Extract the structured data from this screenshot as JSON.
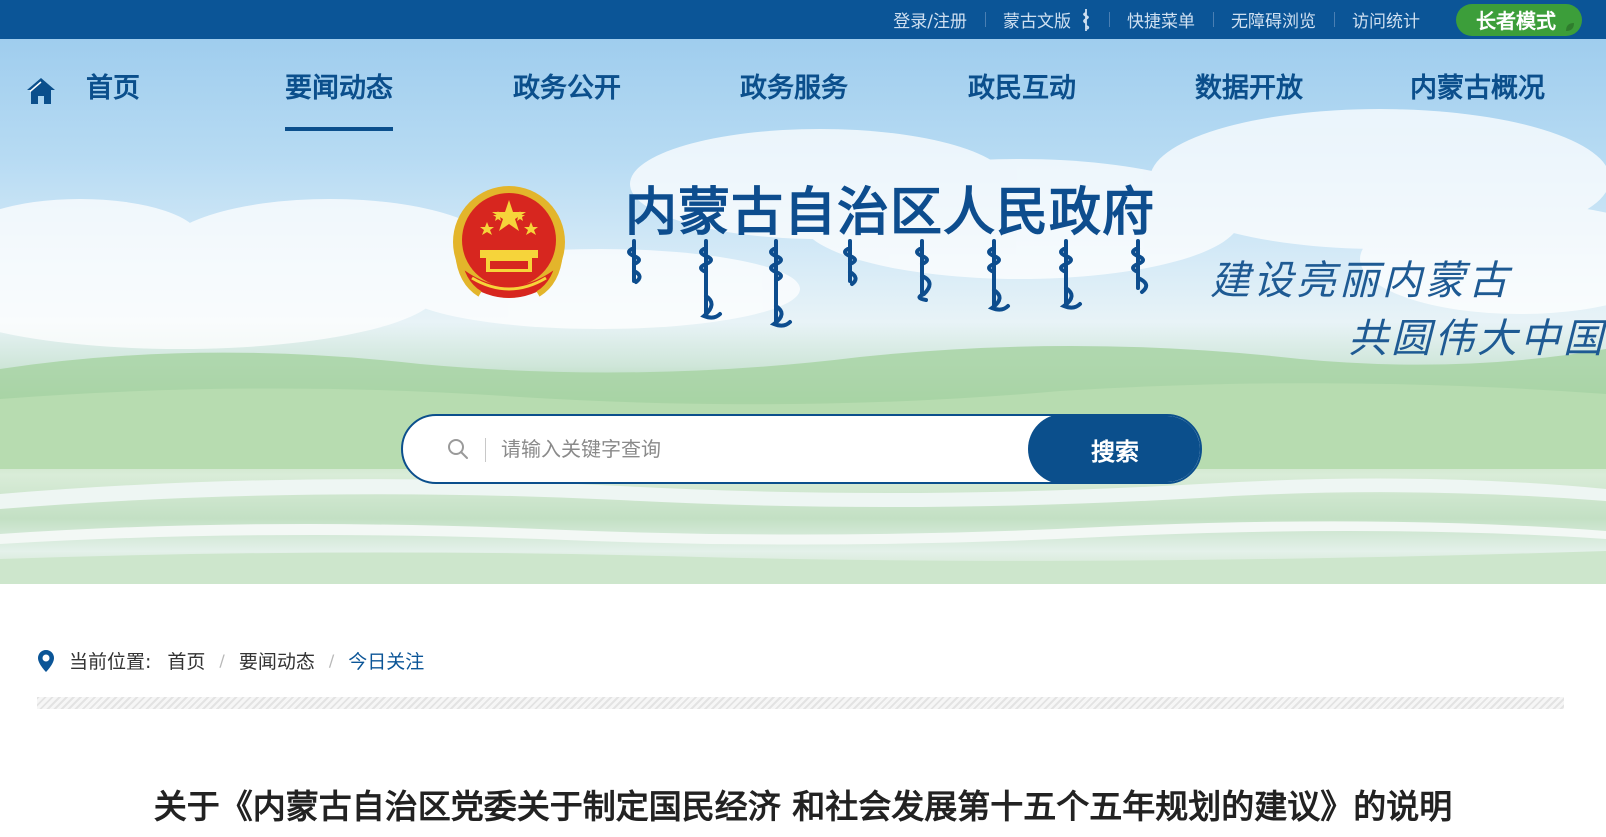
{
  "topbar": {
    "links": [
      "登录/注册",
      "蒙古文版",
      "快捷菜单",
      "无障碍浏览",
      "访问统计"
    ],
    "elder_mode": "长者模式"
  },
  "nav": {
    "items": [
      "首页",
      "要闻动态",
      "政务公开",
      "政务服务",
      "政民互动",
      "数据开放",
      "内蒙古概况"
    ],
    "active": "要闻动态"
  },
  "header": {
    "title": "内蒙古自治区人民政府",
    "slogan_line1": "建设亮丽内蒙古",
    "slogan_line2": "共圆伟大中国梦"
  },
  "search": {
    "placeholder": "请输入关键字查询",
    "button": "搜索"
  },
  "breadcrumb": {
    "label": "当前位置:",
    "items": [
      "首页",
      "要闻动态",
      "今日关注"
    ],
    "separator": "/"
  },
  "article": {
    "title": "关于《内蒙古自治区党委关于制定国民经济 和社会发展第十五个五年规划的建议》的说明"
  },
  "colors": {
    "primary": "#0b5597",
    "nav_text": "#0b4f8c",
    "elder_green": "#3c9e3a"
  }
}
